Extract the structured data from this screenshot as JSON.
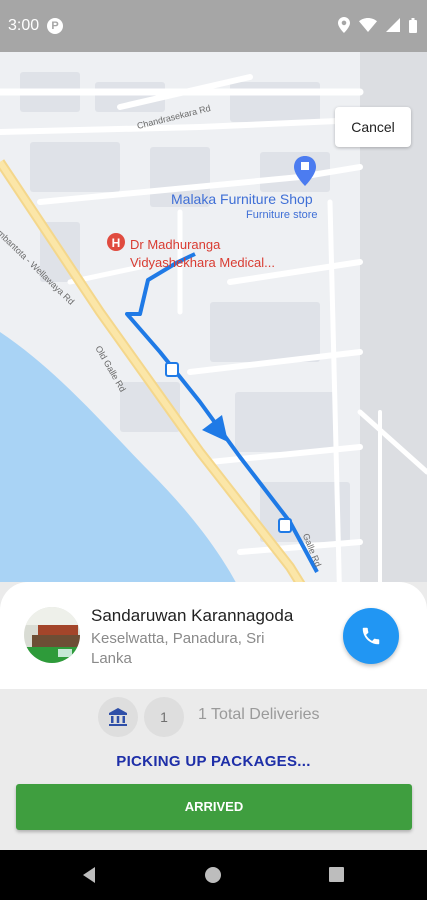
{
  "status_bar": {
    "time": "3:00",
    "icons": [
      "app-notification-icon",
      "location-icon",
      "wifi-icon",
      "signal-icon",
      "battery-icon"
    ]
  },
  "map": {
    "poi_shop_name": "Malaka Furniture Shop",
    "poi_shop_category": "Furniture store",
    "poi_medical_line1": "Dr Madhuranga",
    "poi_medical_line2": "Vidyashekhara Medical...",
    "road_chandrasekara": "Chandrasekara Rd",
    "road_hambantota": "Hambantota - Wellawaya Rd",
    "road_old_galle": "Old Galle Rd",
    "road_galle_right": "Galle Rd",
    "colors": {
      "route": "#1f7ae6",
      "water": "#a9d3f5",
      "poi_shop": "#3f6fd6",
      "poi_medical": "#d93c32"
    }
  },
  "cancel_label": "Cancel",
  "customer": {
    "name": "Sandaruwan Karannagoda",
    "address": "Keselwatta, Panadura, Sri Lanka"
  },
  "deliveries": {
    "count": "1",
    "label": "1 Total Deliveries"
  },
  "status_text": "PICKING UP PACKAGES...",
  "arrived_label": "ARRIVED",
  "colors": {
    "call_button": "#2196f3",
    "arrived_button": "#3f9e3f",
    "status_text": "#1e2fa8"
  }
}
